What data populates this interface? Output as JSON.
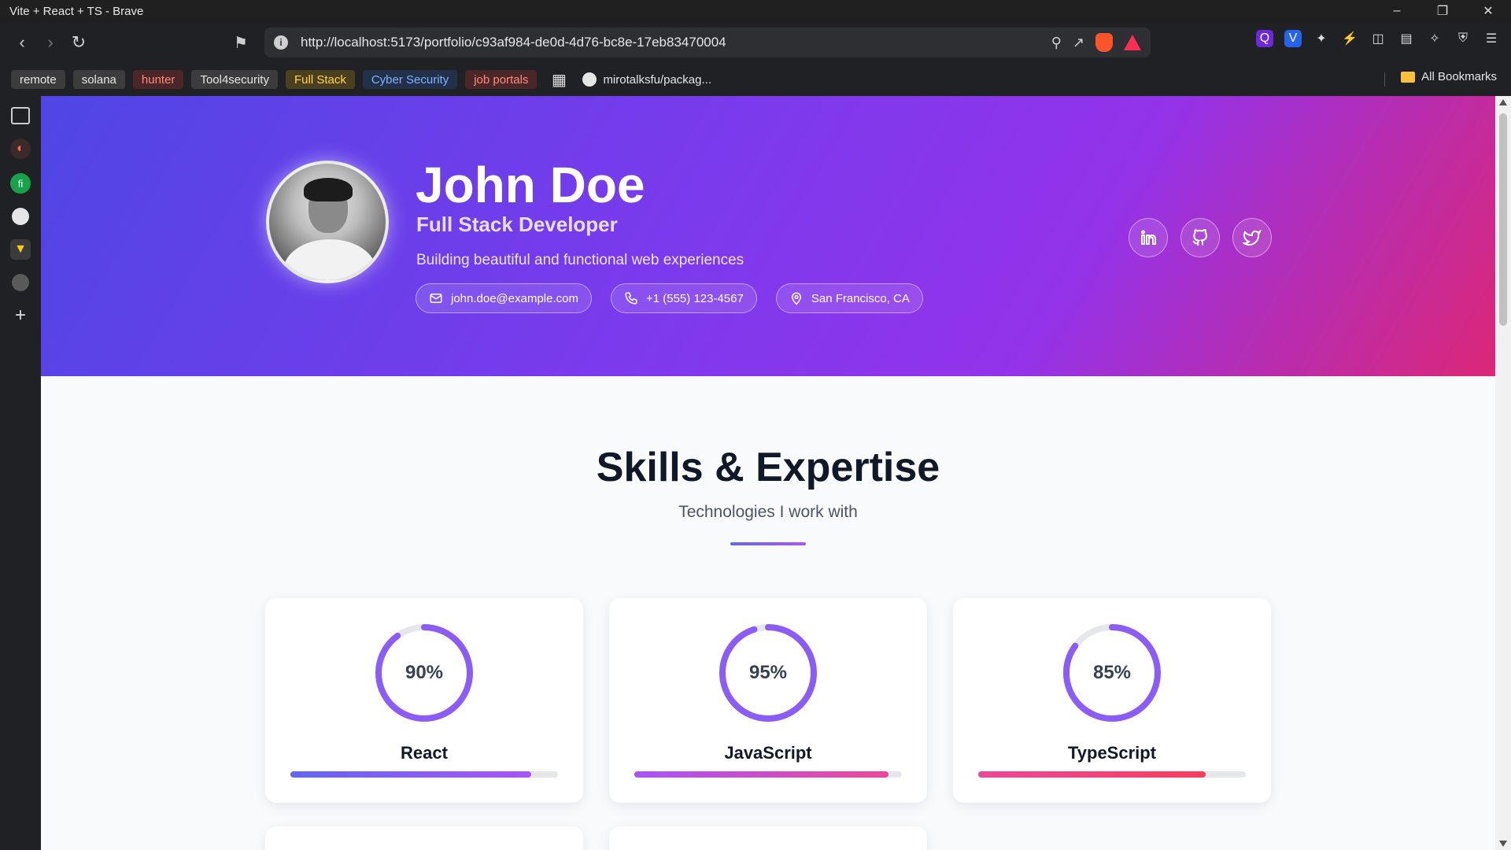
{
  "window": {
    "title": "Vite + React + TS - Brave"
  },
  "browser": {
    "url": "http://localhost:5173/portfolio/c93af984-de0d-4d76-bc8e-17eb83470004",
    "bookmarks": [
      {
        "label": "remote",
        "style": "grey"
      },
      {
        "label": "solana",
        "style": "grey"
      },
      {
        "label": "hunter",
        "style": "red"
      },
      {
        "label": "Tool4security",
        "style": "grey"
      },
      {
        "label": "Full Stack",
        "style": "yellow"
      },
      {
        "label": "Cyber Security",
        "style": "blue"
      },
      {
        "label": "job portals",
        "style": "red"
      }
    ],
    "github_bookmark": "mirotalksfu/packag...",
    "all_bookmarks": "All Bookmarks"
  },
  "profile": {
    "name": "John Doe",
    "role": "Full Stack Developer",
    "tagline": "Building beautiful and functional web experiences",
    "email": "john.doe@example.com",
    "phone": "+1 (555) 123-4567",
    "location": "San Francisco, CA"
  },
  "skills": {
    "title": "Skills & Expertise",
    "subtitle": "Technologies I work with",
    "items": [
      {
        "name": "React",
        "percent": 90,
        "label": "90%",
        "bar_from": "#6366f1",
        "bar_to": "#a855f7"
      },
      {
        "name": "JavaScript",
        "percent": 95,
        "label": "95%",
        "bar_from": "#a855f7",
        "bar_to": "#ec4899"
      },
      {
        "name": "TypeScript",
        "percent": 85,
        "label": "85%",
        "bar_from": "#ec4899",
        "bar_to": "#f43f5e"
      }
    ]
  },
  "colors": {
    "hero_start": "#4f46e5",
    "hero_end": "#db2777",
    "ring_from": "#8b5cf6",
    "ring_to": "#6366f1"
  }
}
